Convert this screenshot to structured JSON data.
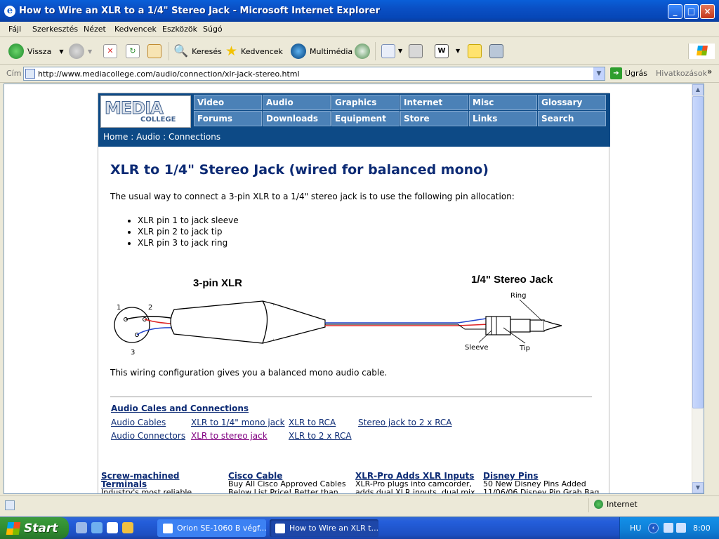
{
  "window": {
    "title": "How to Wire an XLR to a 1/4\" Stereo Jack - Microsoft Internet Explorer"
  },
  "menu": [
    "Fájl",
    "Szerkesztés",
    "Nézet",
    "Kedvencek",
    "Eszközök",
    "Súgó"
  ],
  "toolbar": {
    "back": "Vissza",
    "search": "Keresés",
    "favorites": "Kedvencek",
    "media": "Multimédia"
  },
  "address": {
    "label": "Cím",
    "url": "http://www.mediacollege.com/audio/connection/xlr-jack-stereo.html",
    "go": "Ugrás",
    "links": "Hivatkozások"
  },
  "site": {
    "logo_main": "MEDIA",
    "logo_sub": "COLLEGE",
    "nav_row1": [
      "Video",
      "Audio",
      "Graphics",
      "Internet",
      "Misc",
      "Glossary"
    ],
    "nav_row2": [
      "Forums",
      "Downloads",
      "Equipment",
      "Store",
      "Links",
      "Search"
    ],
    "breadcrumb": [
      "Home",
      "Audio",
      "Connections"
    ],
    "breadcrumb_sep": ":"
  },
  "article": {
    "title": "XLR to 1/4\" Stereo Jack (wired for balanced mono)",
    "intro": "The usual way to connect a 3-pin XLR to a 1/4\" stereo jack is to use the following pin allocation:",
    "bullets": [
      "XLR pin 1 to jack sleeve",
      "XLR pin 2 to jack tip",
      "XLR pin 3 to jack ring"
    ],
    "diagram": {
      "xlr_label": "3-pin XLR",
      "jack_label": "1/4\" Stereo Jack",
      "pin1": "1",
      "pin2": "2",
      "pin3": "3",
      "ring": "Ring",
      "sleeve": "Sleeve",
      "tip": "Tip"
    },
    "conclusion": "This wiring configuration gives you a balanced mono audio cable."
  },
  "related": {
    "title": "Audio Cales and Connections",
    "links": [
      "Audio Cables",
      "XLR to 1/4\" mono jack",
      "XLR to RCA",
      "Stereo jack to 2 x RCA",
      "Audio Connectors",
      "XLR to stereo jack",
      "XLR to 2 x RCA"
    ]
  },
  "ads": [
    {
      "title": "Screw-machined Terminals",
      "body": "Industry's most reliable"
    },
    {
      "title": "Cisco Cable",
      "body": "Buy All Cisco Approved Cables Below List Price! Better than"
    },
    {
      "title": "XLR-Pro Adds XLR Inputs",
      "body": "XLR-Pro plugs into camcorder, adds dual XLR inputs, dual mix"
    },
    {
      "title": "Disney Pins",
      "body": "50 New Disney Pins Added 11/06/06 Disney Pin Grab Bag"
    }
  ],
  "status": {
    "zone": "Internet"
  },
  "taskbar": {
    "start": "Start",
    "tasks": [
      "Orion SE-1060 B végf...",
      "How to Wire an XLR t..."
    ],
    "lang": "HU",
    "clock": "8:00"
  },
  "colors": {
    "nav_cell": "#4b81b7",
    "header": "#0d4a86",
    "title_text": "#0b2a74"
  }
}
